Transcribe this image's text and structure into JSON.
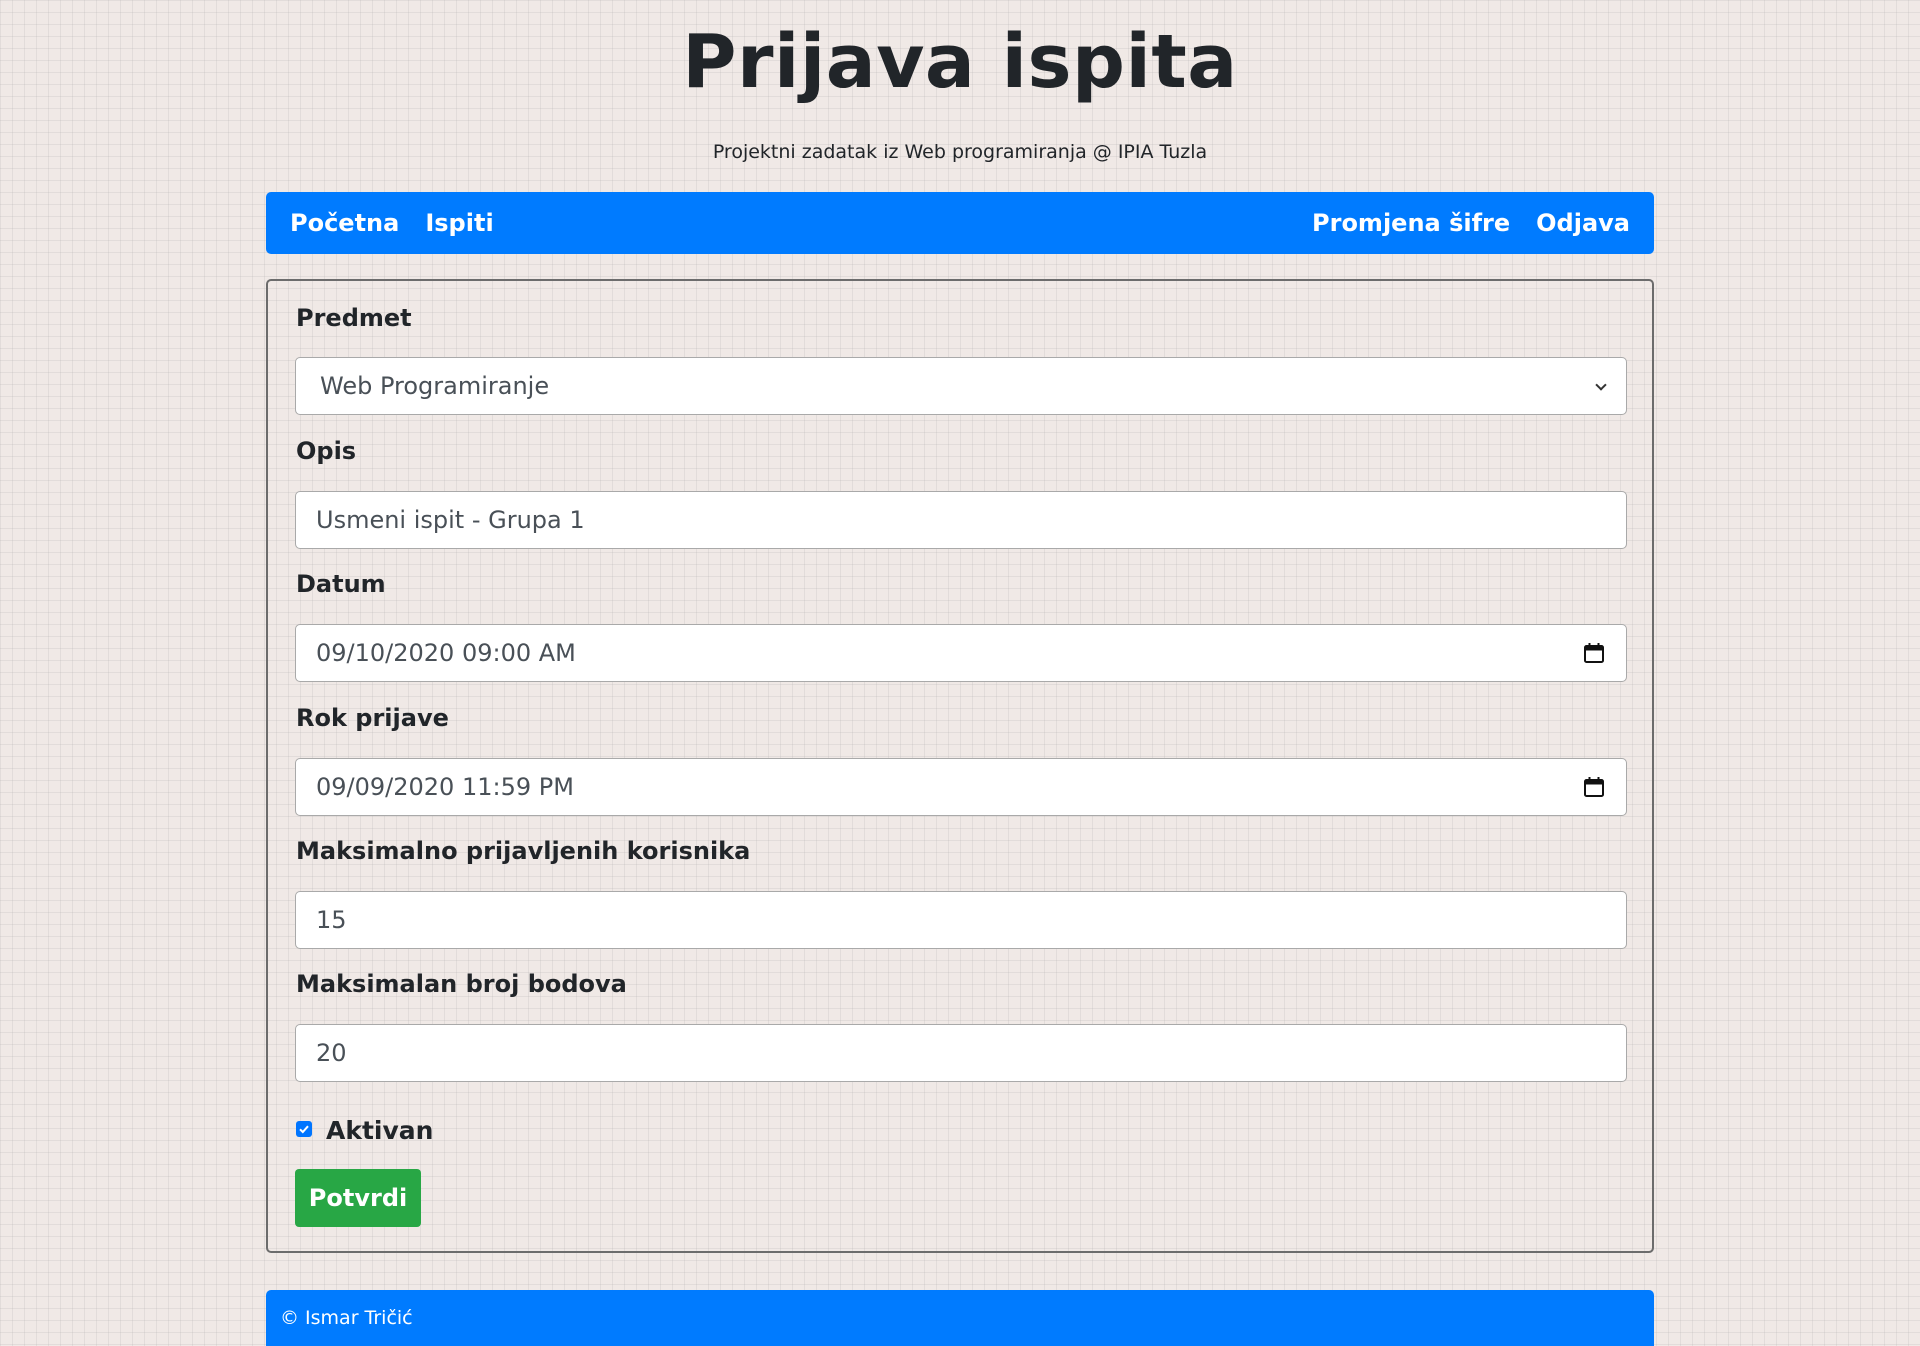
{
  "header": {
    "title": "Prijava ispita",
    "subtitle": "Projektni zadatak iz Web programiranja @ IPIA Tuzla"
  },
  "nav": {
    "left": [
      "Početna",
      "Ispiti"
    ],
    "right": [
      "Promjena šifre",
      "Odjava"
    ]
  },
  "form": {
    "predmet": {
      "label": "Predmet",
      "value": "Web Programiranje"
    },
    "opis": {
      "label": "Opis",
      "value": "Usmeni ispit - Grupa 1"
    },
    "datum": {
      "label": "Datum",
      "value": "09/10/2020 09:00 AM"
    },
    "rok_prijave": {
      "label": "Rok prijave",
      "value": "09/09/2020 11:59 PM"
    },
    "max_korisnika": {
      "label": "Maksimalno prijavljenih korisnika",
      "value": "15"
    },
    "max_bodova": {
      "label": "Maksimalan broj bodova",
      "value": "20"
    },
    "aktivan": {
      "label": "Aktivan",
      "checked": true
    },
    "submit_label": "Potvrdi"
  },
  "footer": {
    "text": "© Ismar Tričić"
  },
  "colors": {
    "primary": "#007bff",
    "success": "#28a745",
    "checkbox": "#0075ff"
  },
  "icons": [
    "chevron-down-icon",
    "calendar-icon",
    "checkmark-icon"
  ]
}
